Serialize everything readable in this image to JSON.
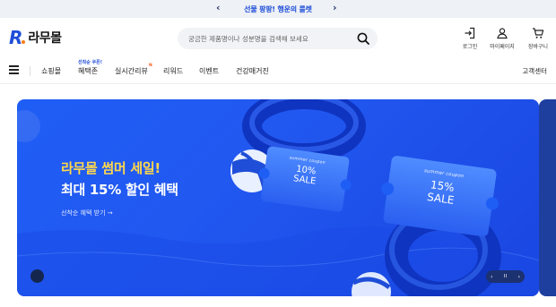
{
  "announcement": {
    "prev": "‹",
    "text": "선물 팡팡! 행운의 룰렛",
    "next": "›"
  },
  "header": {
    "logo_text": "라무몰",
    "search_placeholder": "궁금한 제품명이나 성분명을 검색해 보세요",
    "utils": [
      {
        "icon": "login-icon",
        "label": "로그인"
      },
      {
        "icon": "mypage-icon",
        "label": "마이페이지"
      },
      {
        "icon": "cart-icon",
        "label": "장바구니"
      }
    ]
  },
  "nav": {
    "items": [
      {
        "label": "쇼핑몰"
      },
      {
        "label": "혜택존",
        "badge": "선착순 쿠폰!"
      },
      {
        "label": "실시간리뷰",
        "new": "N"
      },
      {
        "label": "리워드"
      },
      {
        "label": "이벤트"
      },
      {
        "label": "건강매거진"
      }
    ],
    "right": "고객센터"
  },
  "banner": {
    "title": "라무몰 썸머 세일!",
    "subtitle": "최대 15% 할인 혜택",
    "link": "선착순 혜택 받기 →",
    "coupon1": {
      "tag": "summer coupon",
      "value": "10%",
      "word": "SALE"
    },
    "coupon2": {
      "tag": "summer coupon",
      "value": "15%",
      "word": "SALE"
    },
    "pager": {
      "prev": "‹",
      "page": "II",
      "next": "›"
    }
  },
  "colors": {
    "brand": "#1f4ed8",
    "banner": "#1f5ef5",
    "accent_yellow": "#ffd84a"
  }
}
